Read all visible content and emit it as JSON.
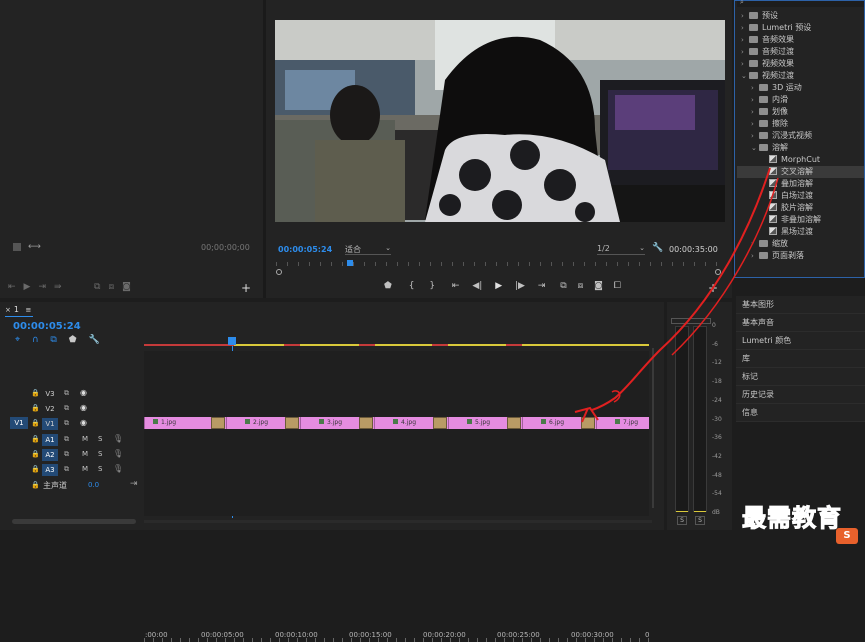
{
  "source_monitor": {
    "timecode": "00;00;00;00"
  },
  "program_monitor": {
    "timecode": "00:00:05:24",
    "fit_label": "适合",
    "resolution": "1/2",
    "duration": "00:00:35:00"
  },
  "effects_tree": [
    {
      "label": "预设",
      "depth": 0,
      "kind": "folder"
    },
    {
      "label": "Lumetri 预设",
      "depth": 0,
      "kind": "folder"
    },
    {
      "label": "音频效果",
      "depth": 0,
      "kind": "folder"
    },
    {
      "label": "音频过渡",
      "depth": 0,
      "kind": "folder"
    },
    {
      "label": "视频效果",
      "depth": 0,
      "kind": "folder"
    },
    {
      "label": "视频过渡",
      "depth": 0,
      "kind": "folder-open"
    },
    {
      "label": "3D 运动",
      "depth": 1,
      "kind": "folder"
    },
    {
      "label": "内滑",
      "depth": 1,
      "kind": "folder"
    },
    {
      "label": "划像",
      "depth": 1,
      "kind": "folder"
    },
    {
      "label": "擦除",
      "depth": 1,
      "kind": "folder"
    },
    {
      "label": "沉浸式视频",
      "depth": 1,
      "kind": "folder"
    },
    {
      "label": "溶解",
      "depth": 1,
      "kind": "folder-open"
    },
    {
      "label": "MorphCut",
      "depth": 2,
      "kind": "effect"
    },
    {
      "label": "交叉溶解",
      "depth": 2,
      "kind": "effect",
      "selected": true
    },
    {
      "label": "叠加溶解",
      "depth": 2,
      "kind": "effect"
    },
    {
      "label": "白场过渡",
      "depth": 2,
      "kind": "effect"
    },
    {
      "label": "胶片溶解",
      "depth": 2,
      "kind": "effect"
    },
    {
      "label": "非叠加溶解",
      "depth": 2,
      "kind": "effect"
    },
    {
      "label": "黑场过渡",
      "depth": 2,
      "kind": "effect"
    },
    {
      "label": "缩放",
      "depth": 1,
      "kind": "folder"
    },
    {
      "label": "页面剥落",
      "depth": 1,
      "kind": "folder"
    }
  ],
  "side_panels": [
    "基本图形",
    "基本声音",
    "Lumetri 颜色",
    "库",
    "标记",
    "历史记录",
    "信息"
  ],
  "timeline": {
    "tab": "1",
    "timecode": "00:00:05:24",
    "ruler_labels": [
      ":00:00",
      "00:00:05:00",
      "00:00:10:00",
      "00:00:15:00",
      "00:00:20:00",
      "00:00:25:00",
      "00:00:30:00",
      "0"
    ],
    "video_tracks": [
      "V3",
      "V2",
      "V1"
    ],
    "audio_tracks": [
      "A1",
      "A2",
      "A3"
    ],
    "master_label": "主声道",
    "master_value": "0.0",
    "source_patch": "V1",
    "clips": [
      "1.jpg",
      "2.jpg",
      "3.jpg",
      "4.jpg",
      "5.jpg",
      "6.jpg",
      "7.jpg"
    ],
    "mute_label": "M",
    "solo_label": "S"
  },
  "meter": {
    "scale": [
      "0",
      "-6",
      "-12",
      "-18",
      "-24",
      "-30",
      "-36",
      "-42",
      "-48",
      "-54",
      "dB"
    ],
    "solo_left": "S",
    "solo_right": "S"
  },
  "watermark": {
    "text": "最需教育"
  },
  "colors": {
    "accent": "#2d8ceb",
    "clip": "#e58ce0",
    "annotation": "#e02020"
  }
}
